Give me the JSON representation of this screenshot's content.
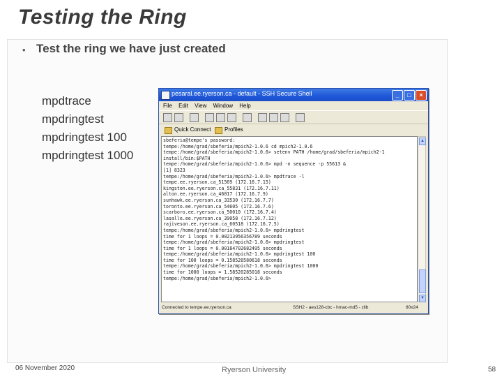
{
  "slide": {
    "title": "Testing the Ring",
    "bullet_marker": "•",
    "bullet": "Test the ring we have just created",
    "commands": [
      "mpdtrace",
      "mpdringtest",
      "mpdringtest 100",
      "mpdringtest 1000"
    ],
    "footer": {
      "date": "06 November 2020",
      "center": "Ryerson University",
      "page": "58"
    }
  },
  "window": {
    "title": "pesaral.ee.ryerson.ca - default - SSH Secure Shell",
    "menu": [
      "File",
      "Edit",
      "View",
      "Window",
      "Help"
    ],
    "quick_connect": "Quick Connect",
    "profiles": "Profiles",
    "terminal_lines": [
      "sbeferia@tempe's password:",
      "tempe:/home/grad/sbeferia/mpich2-1.0.6 cd mpich2-1.0.6",
      "tempe:/home/grad/sbeferia/mpich2-1.0.6> setenv PATH /home/grad/sbeferia/mpich2-1",
      "install/bin:$PATH",
      "tempe:/home/grad/sbeferia/mpich2-1.0.6> mpd -n sequence -p 55613 &",
      "[1] 8323",
      "tempe:/home/grad/sbeferia/mpich2-1.0.6> mpdtrace -l",
      "tempe.ee.ryerson.ca_51569 (172.16.7.15)",
      "kingston.ee.ryerson.ca_55831 (172.16.7.11)",
      "alton.ee.ryerson.ca_46017 (172.16.7.9)",
      "sunhawk.ee.ryerson.ca_33530 (172.16.7.7)",
      "toronto.ee.ryerson.ca_54605 (172.16.7.6)",
      "scarboro.ee.ryerson.ca_50010 (172.16.7.4)",
      "lasalle.ee.ryerson.ca_39058 (172.16.7.12)",
      "rajiveson.ee.ryerson.ca_60518 (172.16.7.5)",
      "tempe:/home/grad/sbeferia/mpich2-1.0.6> mpdringtest",
      "time for 1 loops = 0.00213956356789 seconds",
      "tempe:/home/grad/sbeferia/mpich2-1.0.6> mpdringtest",
      "time for 1 loops = 0.00184702682495 seconds",
      "tempe:/home/grad/sbeferia/mpich2-1.0.6> mpdringtest 100",
      "time for 100 loops = 0.158528580618 seconds",
      "tempe:/home/grad/sbeferia/mpich2-1.0.6> mpdringtest 1000",
      "time for 1000 loops = 1.58520285018 seconds",
      "tempe:/home/grad/sbeferia/mpich2-1.0.6>"
    ],
    "status": {
      "left": "Connected to tempe.ee.ryerson.ca",
      "ssh": "SSH2 - aes128-cbc - hmac-md5 - zlib",
      "size": "80x24"
    }
  }
}
